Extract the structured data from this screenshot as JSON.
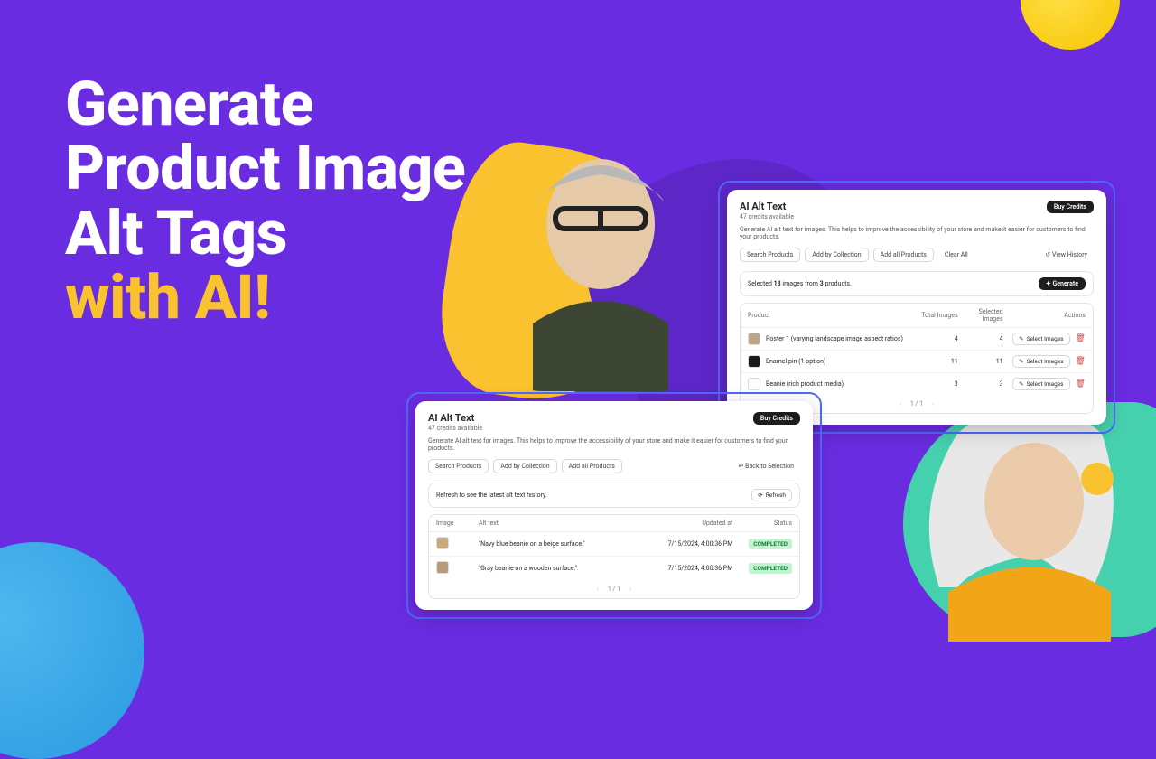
{
  "colors": {
    "bg": "#6a2ce0",
    "accent": "#f9c22e",
    "blob_green": "#46d1ae",
    "frame": "#5068ff"
  },
  "headline": {
    "line1": "Generate",
    "line2": "Product Image",
    "line3": "Alt Tags",
    "line4": "with AI!"
  },
  "panel_right": {
    "title": "AI Alt Text",
    "credits": "47 credits available",
    "buy_credits": "Buy Credits",
    "description": "Generate AI alt text for images. This helps to improve the accessibility of your store and make it easier for customers to find your products.",
    "buttons": {
      "search": "Search Products",
      "collection": "Add by Collection",
      "add_all": "Add all Products",
      "clear": "Clear All",
      "view_history": "View History"
    },
    "selection_bar": {
      "text_prefix": "Selected ",
      "count": "18",
      "text_mid": " images from ",
      "prod_count": "3",
      "text_suffix": " products.",
      "generate": "Generate"
    },
    "columns": {
      "product": "Product",
      "total": "Total Images",
      "selected": "Selected Images",
      "actions": "Actions"
    },
    "rows": [
      {
        "name": "Poster 1 (varying landscape image aspect ratios)",
        "total": "4",
        "selected": "4",
        "thumb": "#bfa489",
        "action": "Select Images"
      },
      {
        "name": "Enamel pin (1 option)",
        "total": "11",
        "selected": "11",
        "thumb": "#1b1b1b",
        "action": "Select Images"
      },
      {
        "name": "Beanie (rich product media)",
        "total": "3",
        "selected": "3",
        "thumb": "#ffffff",
        "action": "Select Images"
      }
    ],
    "pager": "1 / 1"
  },
  "panel_left": {
    "title": "AI Alt Text",
    "credits": "47 credits available",
    "buy_credits": "Buy Credits",
    "description": "Generate AI alt text for images. This helps to improve the accessibility of your store and make it easier for customers to find your products.",
    "buttons": {
      "search": "Search Products",
      "collection": "Add by Collection",
      "add_all": "Add all Products",
      "back": "Back to Selection"
    },
    "refresh_bar": {
      "text": "Refresh to see the latest alt text history.",
      "refresh": "Refresh"
    },
    "columns": {
      "image": "Image",
      "alt": "Alt text",
      "updated": "Updated at",
      "status": "Status"
    },
    "rows": [
      {
        "thumb": "#c7a97f",
        "alt": "\"Navy blue beanie on a beige surface.\"",
        "updated": "7/15/2024, 4:00:36 PM",
        "status": "COMPLETED"
      },
      {
        "thumb": "#b79c7a",
        "alt": "\"Gray beanie on a wooden surface.\"",
        "updated": "7/15/2024, 4:00:36 PM",
        "status": "COMPLETED"
      }
    ],
    "pager": "1 / 1"
  }
}
